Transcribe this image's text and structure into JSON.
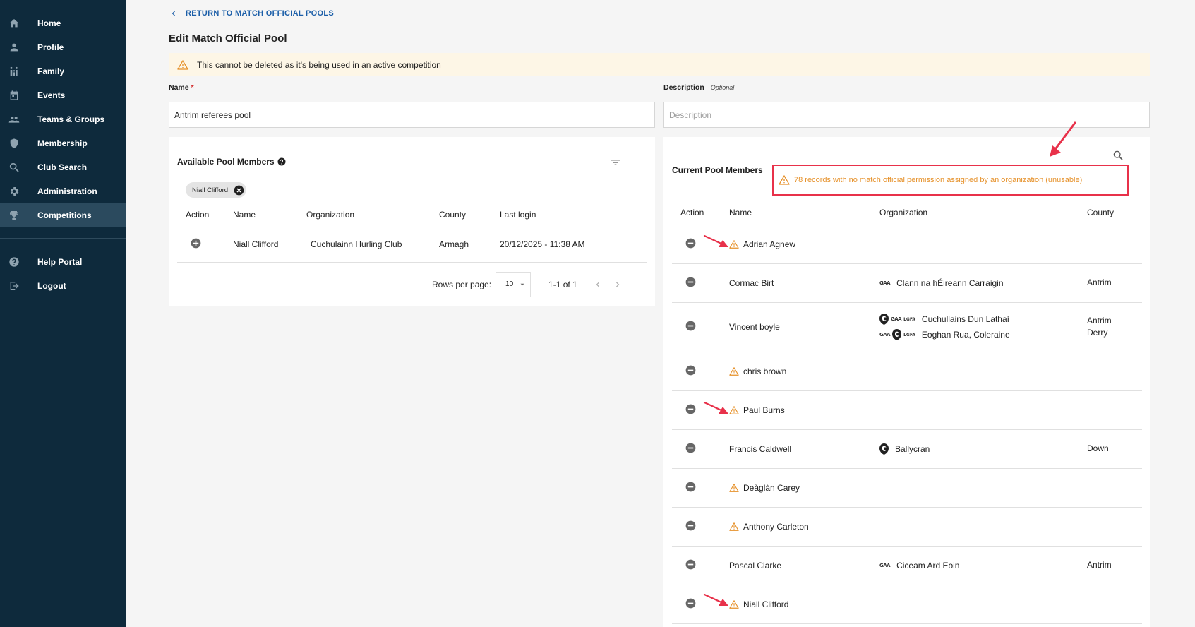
{
  "sidebar": {
    "items": [
      {
        "label": "Home",
        "icon": "home-icon"
      },
      {
        "label": "Profile",
        "icon": "person-icon"
      },
      {
        "label": "Family",
        "icon": "family-icon"
      },
      {
        "label": "Events",
        "icon": "calendar-icon"
      },
      {
        "label": "Teams & Groups",
        "icon": "group-icon"
      },
      {
        "label": "Membership",
        "icon": "shield-icon"
      },
      {
        "label": "Club Search",
        "icon": "search-icon"
      },
      {
        "label": "Administration",
        "icon": "gear-icon"
      },
      {
        "label": "Competitions",
        "icon": "trophy-icon"
      }
    ],
    "bottom": [
      {
        "label": "Help Portal",
        "icon": "help-icon"
      },
      {
        "label": "Logout",
        "icon": "logout-icon"
      }
    ]
  },
  "header": {
    "back_label": "RETURN TO MATCH OFFICIAL POOLS",
    "title": "Edit Match Official Pool",
    "banner": "This cannot be deleted as it's being used in an active competition"
  },
  "form": {
    "name_label": "Name",
    "name_required": "*",
    "name_value": "Antrim referees pool",
    "description_label": "Description",
    "description_optional": "Optional",
    "description_placeholder": "Description"
  },
  "available": {
    "title": "Available Pool Members",
    "chip": "Niall Clifford",
    "columns": [
      "Action",
      "Name",
      "Organization",
      "County",
      "Last login"
    ],
    "rows": [
      {
        "name": "Niall Clifford",
        "organization": "Cuchulainn Hurling Club",
        "county": "Armagh",
        "last_login": "20/12/2025 - 11:38 AM"
      }
    ],
    "rows_per_page_label": "Rows per page:",
    "rows_per_page": "10",
    "range": "1-1 of 1"
  },
  "current": {
    "title": "Current Pool Members",
    "warning": "78 records with no match official permission assigned by an organization (unusable)",
    "columns": [
      "Action",
      "Name",
      "Organization",
      "County"
    ],
    "rows": [
      {
        "name": "Adrian Agnew",
        "warn": true,
        "orgs": [],
        "counties": []
      },
      {
        "name": "Cormac Birt",
        "warn": false,
        "orgs": [
          {
            "name": "Clann na hÉireann Carraigin",
            "logos": [
              "gaa"
            ]
          }
        ],
        "counties": [
          "Antrim"
        ]
      },
      {
        "name": "Vincent boyle",
        "warn": false,
        "orgs": [
          {
            "name": "Cuchullains Dun Lathaí",
            "logos": [
              "crest",
              "gaa",
              "lgfa"
            ]
          },
          {
            "name": "Eoghan Rua, Coleraine",
            "logos": [
              "gaa",
              "crest",
              "lgfa"
            ]
          }
        ],
        "counties": [
          "Antrim",
          "Derry"
        ]
      },
      {
        "name": "chris brown",
        "warn": true,
        "orgs": [],
        "counties": []
      },
      {
        "name": "Paul Burns",
        "warn": true,
        "orgs": [],
        "counties": []
      },
      {
        "name": "Francis Caldwell",
        "warn": false,
        "orgs": [
          {
            "name": "Ballycran",
            "logos": [
              "crest"
            ]
          }
        ],
        "counties": [
          "Down"
        ]
      },
      {
        "name": "Deàglàn Carey",
        "warn": true,
        "orgs": [],
        "counties": []
      },
      {
        "name": "Anthony Carleton",
        "warn": true,
        "orgs": [],
        "counties": []
      },
      {
        "name": "Pascal Clarke",
        "warn": false,
        "orgs": [
          {
            "name": "Ciceam Ard Eoin",
            "logos": [
              "gaa"
            ]
          }
        ],
        "counties": [
          "Antrim"
        ]
      },
      {
        "name": "Niall Clifford",
        "warn": true,
        "orgs": [],
        "counties": []
      }
    ]
  },
  "logo_text": {
    "gaa": "GAA",
    "lgfa": "LGFA"
  },
  "colors": {
    "sidebar": "#0e2a3c",
    "accent": "#1b5ea8",
    "warning": "#e6912a",
    "annotation": "#e8314a"
  }
}
